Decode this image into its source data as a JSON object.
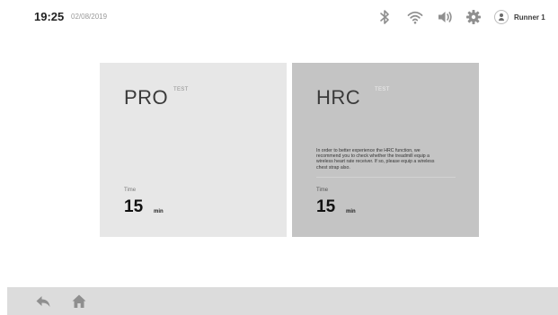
{
  "status": {
    "time": "19:25",
    "date": "02/08/2019",
    "icons": [
      "bluetooth-icon",
      "wifi-icon",
      "volume-icon",
      "settings-gear-icon"
    ],
    "user": {
      "name": "Runner 1",
      "icon": "user-avatar-icon"
    }
  },
  "cards": [
    {
      "title": "PRO",
      "badge": "TEST",
      "description": "",
      "time_label": "Time",
      "time_value": "15",
      "time_unit": "min"
    },
    {
      "title": "HRC",
      "badge": "TEST",
      "description": "In order to better experience the HRC function, we recommend you to check whether the treadmill equip a wireless heart rate receiver. If so, please equip a wireless chest strap also.",
      "time_label": "Time",
      "time_value": "15",
      "time_unit": "min"
    }
  ],
  "nav": {
    "back_icon": "back-arrow-icon",
    "home_icon": "home-icon"
  },
  "colors": {
    "pro_card_bg": "#e7e7e7",
    "hrc_card_bg": "#c4c4c4",
    "bottom_bar_bg": "#dcdcdc",
    "icon_gray": "#8f8f8f"
  }
}
